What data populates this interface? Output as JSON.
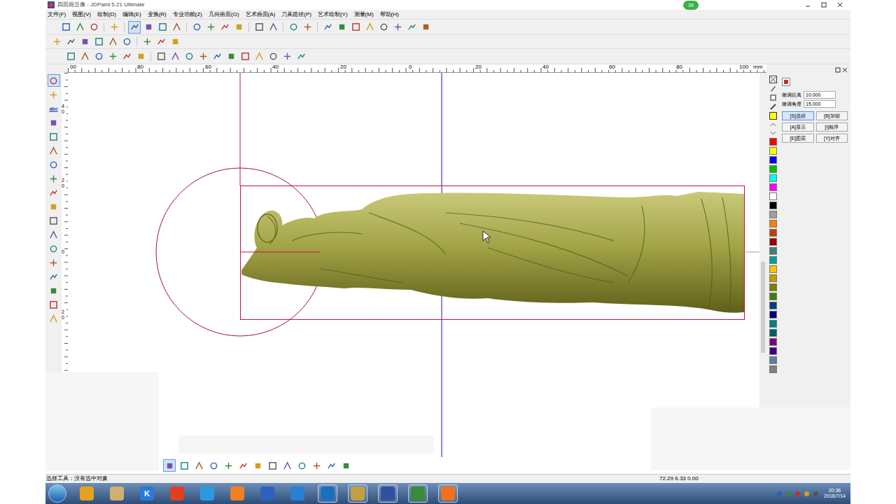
{
  "window": {
    "title": "四面观音像 - JDPaint 5.21 Ultimate",
    "badge": "39"
  },
  "menu": [
    "文件(F)",
    "视图(V)",
    "绘制(D)",
    "编辑(E)",
    "变换(R)",
    "专业功能(Z)",
    "几何曲面(G)",
    "艺术曲面(A)",
    "刀具路径(P)",
    "艺术绘制(Y)",
    "测量(M)",
    "帮助(H)"
  ],
  "toolbar_rows": [
    {
      "buttons": [
        {
          "selected": false
        },
        {
          "selected": false
        },
        {
          "selected": false
        },
        {
          "selected": false
        },
        {
          "selected": true
        },
        {
          "selected": false
        },
        {
          "selected": false
        },
        {
          "selected": false
        },
        {
          "selected": false
        },
        {
          "selected": false
        },
        {
          "selected": false
        },
        {
          "selected": false
        },
        {
          "selected": false
        },
        {
          "selected": false
        },
        {
          "selected": false
        },
        {
          "selected": false
        },
        {
          "selected": false
        },
        {
          "selected": false
        },
        {
          "selected": false
        },
        {
          "selected": false
        },
        {
          "selected": false
        },
        {
          "selected": false
        },
        {
          "selected": false
        },
        {
          "selected": false
        }
      ]
    },
    {
      "buttons": [
        {
          "selected": false
        },
        {
          "selected": false
        },
        {
          "selected": false
        },
        {
          "selected": false
        },
        {
          "selected": false
        },
        {
          "selected": false
        },
        {
          "selected": false
        },
        {
          "selected": false
        },
        {
          "selected": false
        }
      ]
    },
    {
      "buttons": [
        {
          "selected": false
        },
        {
          "selected": false
        },
        {
          "selected": false
        },
        {
          "selected": false
        },
        {
          "selected": false
        },
        {
          "selected": false
        },
        {
          "selected": false
        },
        {
          "selected": false
        },
        {
          "selected": false
        },
        {
          "selected": false
        },
        {
          "selected": false
        },
        {
          "selected": false
        },
        {
          "selected": false
        },
        {
          "selected": false
        },
        {
          "selected": false
        },
        {
          "selected": false
        },
        {
          "selected": false
        }
      ]
    }
  ],
  "left_tools": [
    {
      "selected": true
    },
    {
      "selected": false
    },
    {
      "label": "abc",
      "selected": false
    },
    {
      "selected": false
    },
    {
      "selected": false
    },
    {
      "selected": false
    },
    {
      "selected": false
    },
    {
      "selected": false
    },
    {
      "selected": false
    },
    {
      "selected": false
    },
    {
      "selected": false
    },
    {
      "selected": false
    },
    {
      "selected": false
    },
    {
      "selected": false
    },
    {
      "selected": false
    },
    {
      "selected": false
    },
    {
      "selected": false
    },
    {
      "selected": false
    }
  ],
  "ruler": {
    "h_labels": [
      "00",
      "80",
      "60",
      "40",
      "20",
      "0",
      "20",
      "40",
      "60",
      "80",
      "100"
    ],
    "unit": "mm",
    "v_labels": [
      "40",
      "20",
      "0",
      "20"
    ]
  },
  "palette": [
    {
      "color": "#ff0000"
    },
    {
      "color": "#ffff00"
    },
    {
      "color": "#0000ff"
    },
    {
      "color": "#00c000"
    },
    {
      "color": "#00ffff"
    },
    {
      "color": "#ff00ff"
    },
    {
      "color": "#ffffff"
    },
    {
      "color": "#000000"
    },
    {
      "color": "#a0a0a0"
    },
    {
      "color": "#ff8000"
    },
    {
      "color": "#c04000"
    },
    {
      "color": "#a00000"
    },
    {
      "color": "#408080"
    },
    {
      "color": "#00a0a0"
    },
    {
      "color": "#ffc000"
    },
    {
      "color": "#c0a000"
    },
    {
      "color": "#808000"
    },
    {
      "color": "#408000"
    },
    {
      "color": "#004080"
    },
    {
      "color": "#000080"
    },
    {
      "color": "#008080"
    },
    {
      "color": "#006060"
    },
    {
      "color": "#800080"
    },
    {
      "color": "#400080"
    },
    {
      "color": "#6080a0"
    },
    {
      "color": "#808080"
    }
  ],
  "panel": {
    "fields": [
      {
        "label": "微调距离",
        "value": "10.000"
      },
      {
        "label": "微调角度",
        "value": "15.000"
      }
    ],
    "buttons": [
      {
        "label": "[S]选择",
        "selected": true
      },
      {
        "label": "[B]加锁",
        "selected": false
      },
      {
        "label": "[A]显示",
        "selected": false
      },
      {
        "label": "[I]顺序",
        "selected": false
      },
      {
        "label": "[E]图层",
        "selected": false
      },
      {
        "label": "[Y]对齐",
        "selected": false
      }
    ]
  },
  "bottom_tools": [
    {
      "selected": true
    },
    {
      "selected": false
    },
    {
      "selected": false
    },
    {
      "selected": false
    },
    {
      "selected": false
    },
    {
      "selected": false
    },
    {
      "selected": false
    },
    {
      "selected": false
    },
    {
      "selected": false
    },
    {
      "selected": false
    },
    {
      "selected": false
    },
    {
      "selected": false
    },
    {
      "selected": false
    }
  ],
  "status_bar": {
    "text": "选择工具：没有选中对象",
    "coords": "72.29 6.33 0.00"
  },
  "taskbar": {
    "apps": [
      {
        "active": false
      },
      {
        "active": false
      },
      {
        "label": "K",
        "active": false
      },
      {
        "active": false
      },
      {
        "active": false
      },
      {
        "active": false
      },
      {
        "active": false
      },
      {
        "active": false
      },
      {
        "active": true
      },
      {
        "active": true
      },
      {
        "active": true
      },
      {
        "active": true
      },
      {
        "active": true
      }
    ],
    "time": "20:36",
    "date": "2016/7/14"
  }
}
